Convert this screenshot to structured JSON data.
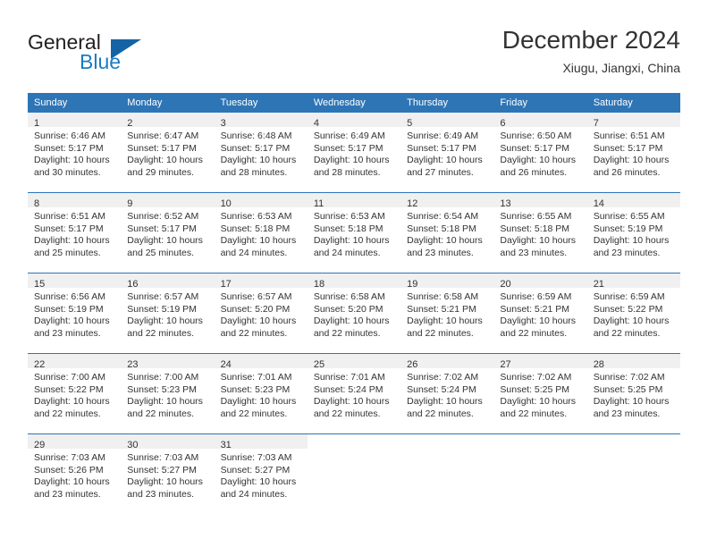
{
  "brand": {
    "name_top": "General",
    "name_bottom": "Blue",
    "triangle_color": "#1464a5",
    "blue_text_color": "#1a7cc1"
  },
  "header": {
    "title": "December 2024",
    "location": "Xiugu, Jiangxi, China"
  },
  "theme": {
    "header_blue": "#2e75b6",
    "daynum_band": "#f0f0f0",
    "text": "#333333"
  },
  "weekdays": [
    "Sunday",
    "Monday",
    "Tuesday",
    "Wednesday",
    "Thursday",
    "Friday",
    "Saturday"
  ],
  "weeks": [
    [
      {
        "day": "1",
        "sunrise": "Sunrise: 6:46 AM",
        "sunset": "Sunset: 5:17 PM",
        "daylight1": "Daylight: 10 hours",
        "daylight2": "and 30 minutes."
      },
      {
        "day": "2",
        "sunrise": "Sunrise: 6:47 AM",
        "sunset": "Sunset: 5:17 PM",
        "daylight1": "Daylight: 10 hours",
        "daylight2": "and 29 minutes."
      },
      {
        "day": "3",
        "sunrise": "Sunrise: 6:48 AM",
        "sunset": "Sunset: 5:17 PM",
        "daylight1": "Daylight: 10 hours",
        "daylight2": "and 28 minutes."
      },
      {
        "day": "4",
        "sunrise": "Sunrise: 6:49 AM",
        "sunset": "Sunset: 5:17 PM",
        "daylight1": "Daylight: 10 hours",
        "daylight2": "and 28 minutes."
      },
      {
        "day": "5",
        "sunrise": "Sunrise: 6:49 AM",
        "sunset": "Sunset: 5:17 PM",
        "daylight1": "Daylight: 10 hours",
        "daylight2": "and 27 minutes."
      },
      {
        "day": "6",
        "sunrise": "Sunrise: 6:50 AM",
        "sunset": "Sunset: 5:17 PM",
        "daylight1": "Daylight: 10 hours",
        "daylight2": "and 26 minutes."
      },
      {
        "day": "7",
        "sunrise": "Sunrise: 6:51 AM",
        "sunset": "Sunset: 5:17 PM",
        "daylight1": "Daylight: 10 hours",
        "daylight2": "and 26 minutes."
      }
    ],
    [
      {
        "day": "8",
        "sunrise": "Sunrise: 6:51 AM",
        "sunset": "Sunset: 5:17 PM",
        "daylight1": "Daylight: 10 hours",
        "daylight2": "and 25 minutes."
      },
      {
        "day": "9",
        "sunrise": "Sunrise: 6:52 AM",
        "sunset": "Sunset: 5:17 PM",
        "daylight1": "Daylight: 10 hours",
        "daylight2": "and 25 minutes."
      },
      {
        "day": "10",
        "sunrise": "Sunrise: 6:53 AM",
        "sunset": "Sunset: 5:18 PM",
        "daylight1": "Daylight: 10 hours",
        "daylight2": "and 24 minutes."
      },
      {
        "day": "11",
        "sunrise": "Sunrise: 6:53 AM",
        "sunset": "Sunset: 5:18 PM",
        "daylight1": "Daylight: 10 hours",
        "daylight2": "and 24 minutes."
      },
      {
        "day": "12",
        "sunrise": "Sunrise: 6:54 AM",
        "sunset": "Sunset: 5:18 PM",
        "daylight1": "Daylight: 10 hours",
        "daylight2": "and 23 minutes."
      },
      {
        "day": "13",
        "sunrise": "Sunrise: 6:55 AM",
        "sunset": "Sunset: 5:18 PM",
        "daylight1": "Daylight: 10 hours",
        "daylight2": "and 23 minutes."
      },
      {
        "day": "14",
        "sunrise": "Sunrise: 6:55 AM",
        "sunset": "Sunset: 5:19 PM",
        "daylight1": "Daylight: 10 hours",
        "daylight2": "and 23 minutes."
      }
    ],
    [
      {
        "day": "15",
        "sunrise": "Sunrise: 6:56 AM",
        "sunset": "Sunset: 5:19 PM",
        "daylight1": "Daylight: 10 hours",
        "daylight2": "and 23 minutes."
      },
      {
        "day": "16",
        "sunrise": "Sunrise: 6:57 AM",
        "sunset": "Sunset: 5:19 PM",
        "daylight1": "Daylight: 10 hours",
        "daylight2": "and 22 minutes."
      },
      {
        "day": "17",
        "sunrise": "Sunrise: 6:57 AM",
        "sunset": "Sunset: 5:20 PM",
        "daylight1": "Daylight: 10 hours",
        "daylight2": "and 22 minutes."
      },
      {
        "day": "18",
        "sunrise": "Sunrise: 6:58 AM",
        "sunset": "Sunset: 5:20 PM",
        "daylight1": "Daylight: 10 hours",
        "daylight2": "and 22 minutes."
      },
      {
        "day": "19",
        "sunrise": "Sunrise: 6:58 AM",
        "sunset": "Sunset: 5:21 PM",
        "daylight1": "Daylight: 10 hours",
        "daylight2": "and 22 minutes."
      },
      {
        "day": "20",
        "sunrise": "Sunrise: 6:59 AM",
        "sunset": "Sunset: 5:21 PM",
        "daylight1": "Daylight: 10 hours",
        "daylight2": "and 22 minutes."
      },
      {
        "day": "21",
        "sunrise": "Sunrise: 6:59 AM",
        "sunset": "Sunset: 5:22 PM",
        "daylight1": "Daylight: 10 hours",
        "daylight2": "and 22 minutes."
      }
    ],
    [
      {
        "day": "22",
        "sunrise": "Sunrise: 7:00 AM",
        "sunset": "Sunset: 5:22 PM",
        "daylight1": "Daylight: 10 hours",
        "daylight2": "and 22 minutes."
      },
      {
        "day": "23",
        "sunrise": "Sunrise: 7:00 AM",
        "sunset": "Sunset: 5:23 PM",
        "daylight1": "Daylight: 10 hours",
        "daylight2": "and 22 minutes."
      },
      {
        "day": "24",
        "sunrise": "Sunrise: 7:01 AM",
        "sunset": "Sunset: 5:23 PM",
        "daylight1": "Daylight: 10 hours",
        "daylight2": "and 22 minutes."
      },
      {
        "day": "25",
        "sunrise": "Sunrise: 7:01 AM",
        "sunset": "Sunset: 5:24 PM",
        "daylight1": "Daylight: 10 hours",
        "daylight2": "and 22 minutes."
      },
      {
        "day": "26",
        "sunrise": "Sunrise: 7:02 AM",
        "sunset": "Sunset: 5:24 PM",
        "daylight1": "Daylight: 10 hours",
        "daylight2": "and 22 minutes."
      },
      {
        "day": "27",
        "sunrise": "Sunrise: 7:02 AM",
        "sunset": "Sunset: 5:25 PM",
        "daylight1": "Daylight: 10 hours",
        "daylight2": "and 22 minutes."
      },
      {
        "day": "28",
        "sunrise": "Sunrise: 7:02 AM",
        "sunset": "Sunset: 5:25 PM",
        "daylight1": "Daylight: 10 hours",
        "daylight2": "and 23 minutes."
      }
    ],
    [
      {
        "day": "29",
        "sunrise": "Sunrise: 7:03 AM",
        "sunset": "Sunset: 5:26 PM",
        "daylight1": "Daylight: 10 hours",
        "daylight2": "and 23 minutes."
      },
      {
        "day": "30",
        "sunrise": "Sunrise: 7:03 AM",
        "sunset": "Sunset: 5:27 PM",
        "daylight1": "Daylight: 10 hours",
        "daylight2": "and 23 minutes."
      },
      {
        "day": "31",
        "sunrise": "Sunrise: 7:03 AM",
        "sunset": "Sunset: 5:27 PM",
        "daylight1": "Daylight: 10 hours",
        "daylight2": "and 24 minutes."
      },
      {
        "day": "",
        "sunrise": "",
        "sunset": "",
        "daylight1": "",
        "daylight2": ""
      },
      {
        "day": "",
        "sunrise": "",
        "sunset": "",
        "daylight1": "",
        "daylight2": ""
      },
      {
        "day": "",
        "sunrise": "",
        "sunset": "",
        "daylight1": "",
        "daylight2": ""
      },
      {
        "day": "",
        "sunrise": "",
        "sunset": "",
        "daylight1": "",
        "daylight2": ""
      }
    ]
  ]
}
